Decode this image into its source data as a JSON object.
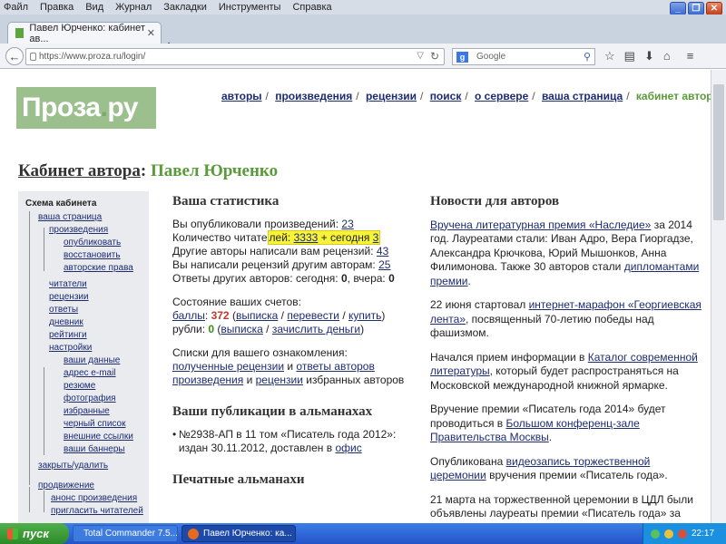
{
  "menu": [
    "Файл",
    "Правка",
    "Вид",
    "Журнал",
    "Закладки",
    "Инструменты",
    "Справка"
  ],
  "tab": {
    "title": "Павел Юрченко: кабинет ав..."
  },
  "address": {
    "url": "https://www.proza.ru/login/"
  },
  "search": {
    "placeholder": "Google"
  },
  "logo": {
    "text_a": "Проза",
    "dot": ".",
    "text_b": "ру"
  },
  "topnav": [
    "авторы",
    "произведения",
    "рецензии",
    "поиск",
    "о сервере",
    "ваша страница",
    "кабинет автора"
  ],
  "page_title": {
    "label": "Кабинет автора",
    "colon": ":",
    "name": "Павел Юрченко"
  },
  "sidebar": {
    "title": "Схема кабинета",
    "items": [
      "ваша страница",
      "произведения",
      "опубликовать",
      "восстановить",
      "авторские права",
      "читатели",
      "рецензии",
      "ответы",
      "дневник",
      "рейтинги",
      "настройки",
      "ваши данные",
      "адрес e-mail",
      "резюме",
      "фотография",
      "избранные",
      "черный список",
      "внешние ссылки",
      "ваши баннеры",
      "закрыть/удалить",
      "продвижение",
      "анонс произведения",
      "пригласить читателей"
    ]
  },
  "stats": {
    "heading": "Ваша статистика",
    "published_label": "Вы опубликовали произведений:",
    "published_value": "23",
    "readers_label_a": "Количество читате",
    "readers_label_b": "лей:",
    "readers_total": "3333",
    "readers_today_label": "+ сегодня",
    "readers_today": "3",
    "reviews_got_label": "Другие авторы написали вам рецензий:",
    "reviews_got": "43",
    "reviews_written_label": "Вы написали рецензий другим авторам:",
    "reviews_written": "25",
    "answers_label": "Ответы других авторов: сегодня:",
    "answers_today": "0",
    "answers_yesterday_label": ", вчера:",
    "answers_yesterday": "0",
    "accounts_heading": "Состояние ваших счетов:",
    "points_label": "баллы",
    "points_value": "372",
    "extract": "выписка",
    "transfer": "перевести",
    "buy": "купить",
    "rubles_label": "рубли:",
    "rubles_value": "0",
    "deposit": "зачислить деньги",
    "lists_heading": "Списки для вашего ознакомления:",
    "received_reviews": "полученные рецензии",
    "and": "и",
    "answers_of_authors": "ответы авторов",
    "works": "произведения",
    "reviews": "рецензии",
    "favorite_authors": "избранных авторов"
  },
  "almanacs": {
    "heading": "Ваши публикации в альманахах",
    "item_text": "№2938-АП в 11 том «Писатель года 2012»: издан 30.11.2012, доставлен в",
    "item_link": "офис",
    "printed_heading": "Печатные альманахи"
  },
  "news": {
    "heading": "Новости для авторов",
    "p1_link": "Вручена литературная премия «Наследие»",
    "p1_text": "за 2014 год. Лауреатами стали: Иван Адро, Вера Гиоргадзе, Александра Крючкова, Юрий Мышонков, Анна Филимонова. Также 30 авторов стали",
    "p1_link2": "дипломантами премии",
    "p2_text_a": "22 июня стартовал",
    "p2_link": "интернет-марафон «Георгиевская лента»",
    "p2_text_b": ", посвященный 70-летию победы над фашизмом.",
    "p3_text_a": "Начался прием информации в",
    "p3_link": "Каталог современной литературы",
    "p3_text_b": ", который будет распространяться на Московской международной книжной ярмарке.",
    "p4_text_a": "Вручение премии «Писатель года 2014» будет проводиться в",
    "p4_link": "Большом конференц-зале Правительства Москвы",
    "p5_text_a": "Опубликована",
    "p5_link": "видеозапись торжественной церемонии",
    "p5_text_b": "вручения премии «Писатель года».",
    "p6_text": "21 марта на торжественной церемонии в ЦДЛ были объявлены лауреаты премии «Писатель года» за"
  },
  "taskbar": {
    "start": "пуск",
    "task1": "Total Commander 7.5...",
    "task2": "Павел Юрченко: ка...",
    "clock": "22:17"
  },
  "colors": {
    "green": "#5a9a3a",
    "link": "#1d2b6f",
    "logo_bg": "#9cbf8e",
    "highlight": "#f7f339"
  }
}
